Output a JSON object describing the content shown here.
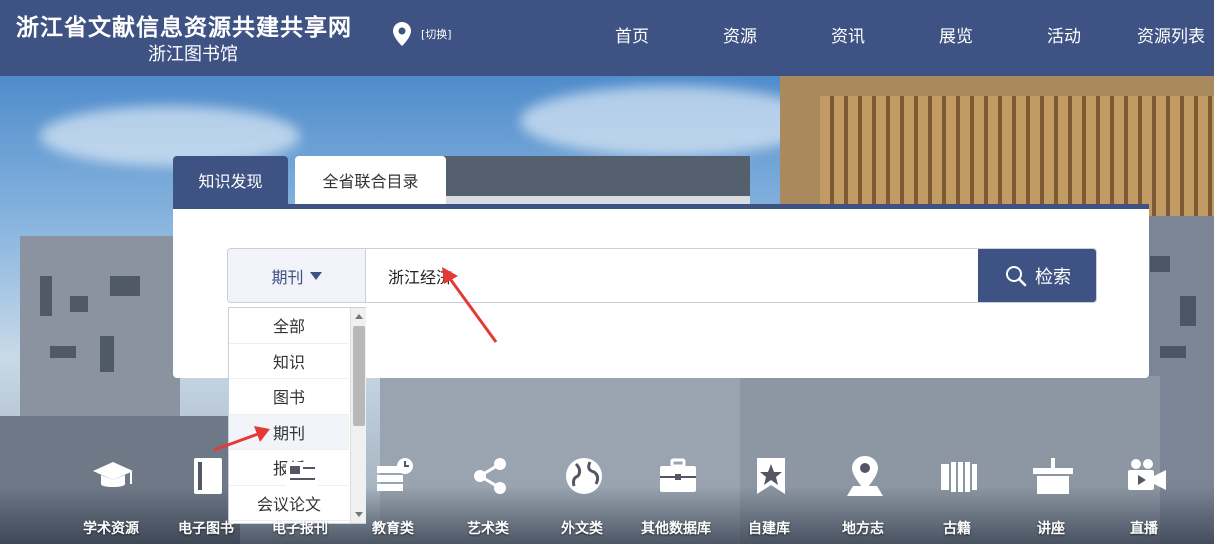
{
  "header": {
    "title": "浙江省文献信息资源共建共享网",
    "subtitle": "浙江图书馆",
    "switch_label": "[切换]",
    "nav": [
      "首页",
      "资源",
      "资讯",
      "展览",
      "活动",
      "资源列表"
    ]
  },
  "search": {
    "tabs": [
      "知识发现",
      "全省联合目录"
    ],
    "active_tab": "知识发现",
    "type_selected": "期刊",
    "query": "浙江经济",
    "button_label": "检索",
    "dropdown_options": [
      "全部",
      "知识",
      "图书",
      "期刊",
      "报纸",
      "会议论文"
    ]
  },
  "categories": [
    {
      "label": "学术资源",
      "icon": "graduation-cap-icon"
    },
    {
      "label": "电子图书",
      "icon": "book-icon"
    },
    {
      "label": "电子报刊",
      "icon": "newspaper-icon"
    },
    {
      "label": "教育类",
      "icon": "education-icon"
    },
    {
      "label": "艺术类",
      "icon": "share-icon"
    },
    {
      "label": "外文类",
      "icon": "globe-icon"
    },
    {
      "label": "其他数据库",
      "icon": "briefcase-icon"
    },
    {
      "label": "自建库",
      "icon": "bookmark-star-icon"
    },
    {
      "label": "地方志",
      "icon": "map-pin-icon"
    },
    {
      "label": "古籍",
      "icon": "ancient-book-icon"
    },
    {
      "label": "讲座",
      "icon": "lectern-icon"
    },
    {
      "label": "直播",
      "icon": "video-camera-icon"
    }
  ],
  "colors": {
    "header_bg": "#3f5284",
    "accent": "#3f5284",
    "annotation_arrow": "#e53935"
  }
}
